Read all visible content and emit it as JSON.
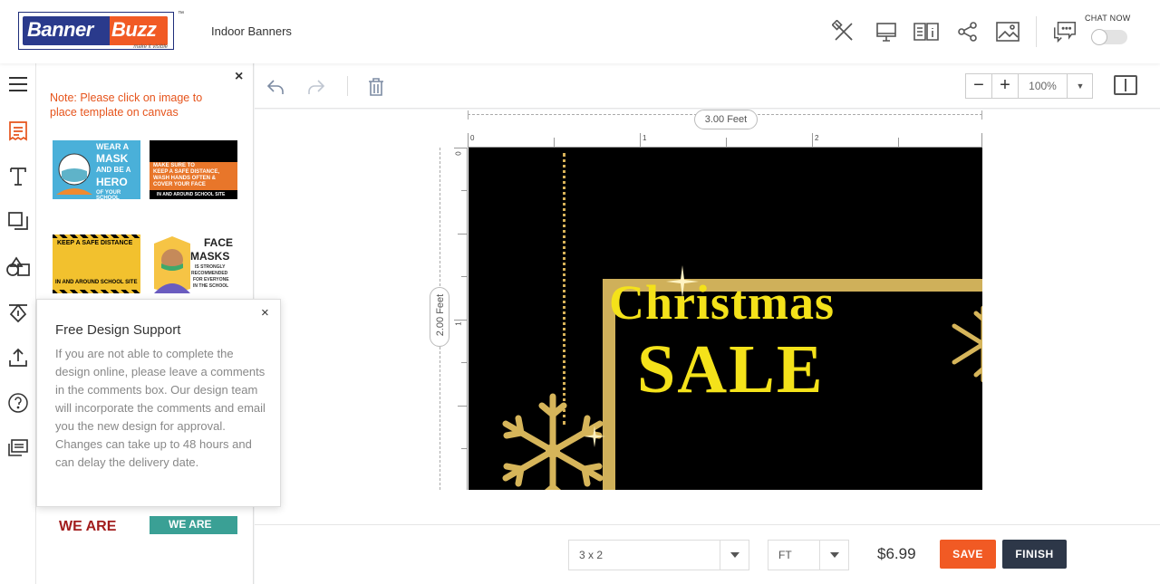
{
  "app": {
    "logo_primary": "Banner",
    "logo_secondary": "Buzz",
    "logo_tagline": "make it visible",
    "logo_tm": "™",
    "page_title": "Indoor Banners"
  },
  "header": {
    "chat_label": "CHAT NOW",
    "chat_toggle_on": false,
    "icons": [
      "design-tools-icon",
      "preview-desktop-icon",
      "product-info-icon",
      "share-icon",
      "image-icon",
      "chat-icon"
    ]
  },
  "left_nav": {
    "items": [
      "menu-icon",
      "templates-icon",
      "text-icon",
      "layers-icon",
      "shapes-icon",
      "clipart-icon",
      "upload-icon",
      "help-icon",
      "comments-icon"
    ]
  },
  "template_panel": {
    "close": "×",
    "note": "Note: Please click on image to place template on canvas",
    "templates": [
      {
        "name": "mask",
        "line1": "WEAR A",
        "line2": "MASK",
        "line3": "AND BE A",
        "line4": "HERO",
        "line5": "OF YOUR SCHOOL"
      },
      {
        "name": "keep-distance-orange",
        "line1": "MAKE SURE TO",
        "line2": "KEEP A SAFE DISTANCE,",
        "line3": "WASH HANDS OFTEN &",
        "line4": "COVER YOUR FACE",
        "line5": "IN AND AROUND SCHOOL SITE"
      },
      {
        "name": "keep-distance-yellow",
        "line1": "KEEP A SAFE DISTANCE",
        "line2": "IN AND AROUND SCHOOL SITE"
      },
      {
        "name": "face-masks",
        "line1": "FACE",
        "line2": "MASKS",
        "line3": "IS STRONGLY",
        "line4": "RECOMMENDED",
        "line5": "FOR EVERYONE",
        "line6": "IN THE SCHOOL"
      },
      {
        "name": "we-are-red",
        "line1": "WE ARE"
      },
      {
        "name": "we-are-teal",
        "line1": "WE ARE"
      }
    ]
  },
  "support_popup": {
    "title": "Free Design Support",
    "close": "×",
    "body": "If you are not able to complete the design online, please leave a comments in the comments box. Our design team will incorporate the comments and email you the new design for approval. Changes can take up to 48 hours and can delay the delivery date."
  },
  "canvas_toolbar": {
    "zoom_minus": "−",
    "zoom_plus": "+",
    "zoom_value": "100%",
    "zoom_dropdown": "▼"
  },
  "canvas": {
    "width_label": "3.00 Feet",
    "height_label": "2.00 Feet",
    "ruler_h": [
      "0",
      "1",
      "2"
    ],
    "ruler_v": [
      "0",
      "1"
    ],
    "design_line1": "Christmas",
    "design_line2": "SALE",
    "colors": {
      "background": "#000000",
      "text": "#f4e21a",
      "gold": "#cfb05a"
    }
  },
  "footer": {
    "size_value": "3 x 2",
    "unit_value": "FT",
    "price": "$6.99",
    "save_label": "SAVE",
    "finish_label": "FINISH",
    "colors": {
      "save": "#f15a24",
      "finish": "#2d3748"
    }
  }
}
